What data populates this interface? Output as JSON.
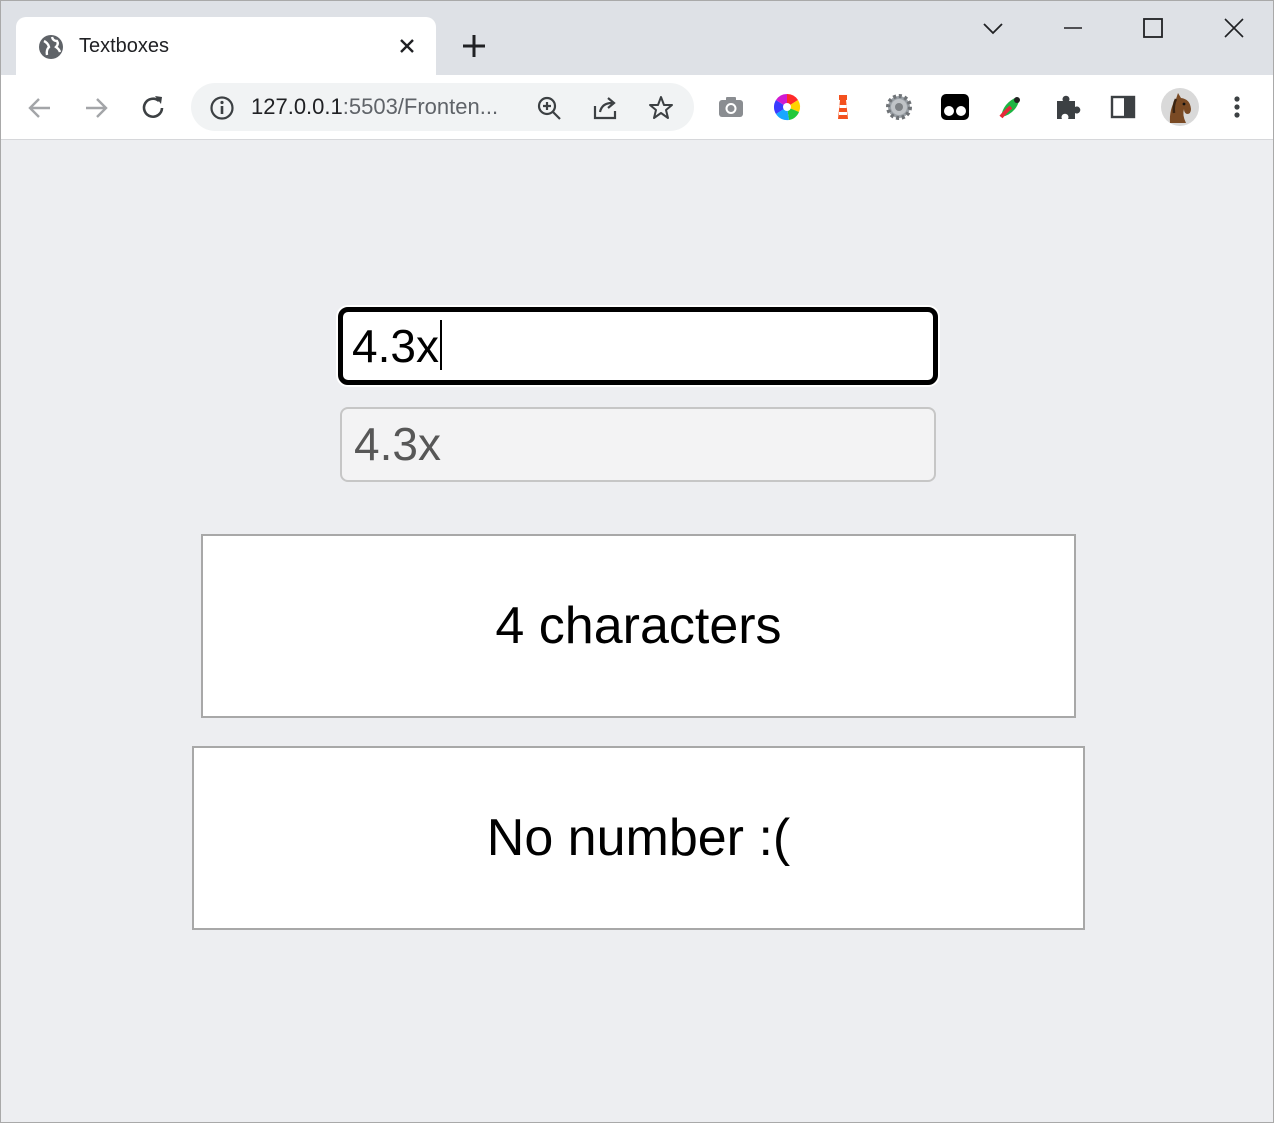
{
  "browser": {
    "tab_title": "Textboxes",
    "url_host": "127.0.0.1",
    "url_rest": ":5503/Fronten..."
  },
  "page": {
    "text_input_value": "4.3x",
    "mirror_value": "4.3x",
    "char_count_text": "4 characters",
    "number_status_text": "No number :("
  },
  "colors": {
    "page_bg": "#edeef1",
    "tabstrip_bg": "#dee1e6",
    "input_border": "#000000",
    "panel_border": "#a8a8a8"
  },
  "icons": {
    "tab": "globe-icon",
    "extensions": [
      "camera-icon",
      "color-wheel-icon",
      "lighthouse-icon",
      "gear-icon",
      "tampermonkey-icon",
      "colorpicker-icon",
      "puzzle-icon",
      "side-panel-icon",
      "profile-avatar"
    ]
  }
}
